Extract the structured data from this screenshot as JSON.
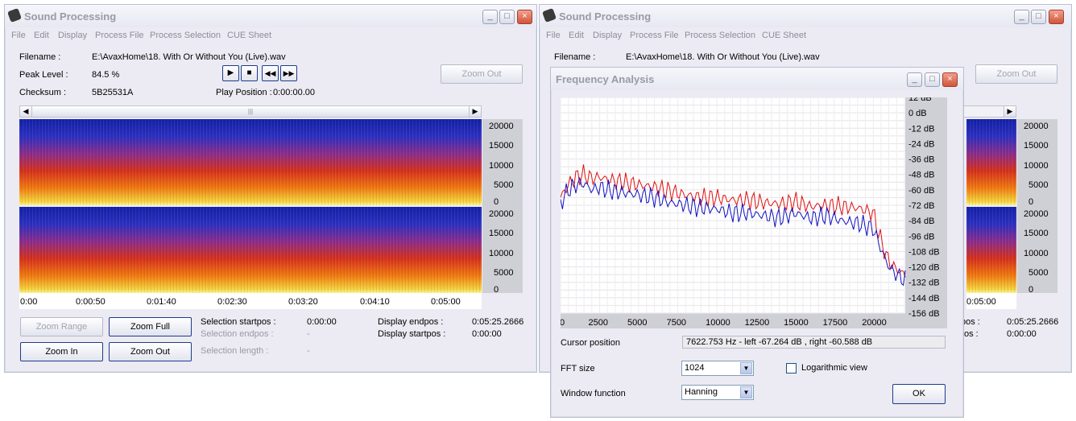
{
  "main_window": {
    "title": "Sound Processing",
    "menu": [
      "File",
      "Edit",
      "Display",
      "Process File",
      "Process Selection",
      "CUE Sheet"
    ],
    "filename_label": "Filename :",
    "filename_value": "E:\\AvaxHome\\18. With Or Without You (Live).wav",
    "peak_label": "Peak Level :",
    "peak_value": "84.5 %",
    "checksum_label": "Checksum :",
    "checksum_value": "5B25531A",
    "play_position_label": "Play Position :",
    "play_position_value": "0:00:00.00",
    "zoom_out_top": "Zoom Out",
    "freq_ticks": [
      "20000",
      "15000",
      "10000",
      "5000",
      "0"
    ],
    "time_ticks": [
      "0:00",
      "0:00:50",
      "0:01:40",
      "0:02:30",
      "0:03:20",
      "0:04:10",
      "0:05:00"
    ],
    "buttons": {
      "zoom_range": "Zoom Range",
      "zoom_full": "Zoom Full",
      "zoom_in": "Zoom In",
      "zoom_out": "Zoom Out"
    },
    "selection_startpos_label": "Selection startpos :",
    "selection_startpos_value": "0:00:00",
    "selection_endpos_label": "Selection endpos :",
    "selection_endpos_value": "-",
    "selection_length_label": "Selection length :",
    "selection_length_value": "-",
    "display_endpos_label": "Display endpos :",
    "display_endpos_value": "0:05:25.2666",
    "display_startpos_label": "Display startpos :",
    "display_startpos_value": "0:00:00"
  },
  "second_window": {
    "title": "Sound Processing",
    "menu": [
      "File",
      "Edit",
      "Display",
      "Process File",
      "Process Selection",
      "CUE Sheet"
    ],
    "filename_label": "Filename :",
    "filename_value": "E:\\AvaxHome\\18. With Or Without You (Live).wav",
    "zoom_out_top": "Zoom Out",
    "freq_ticks": [
      "20000",
      "15000",
      "10000",
      "5000",
      "0"
    ],
    "time_tick": "0:05:00",
    "pos_partial": "pos :",
    "pos_partial2": "os :",
    "display_endpos_value": "0:05:25.2666",
    "display_startpos_value": "0:00:00"
  },
  "freq_dialog": {
    "title": "Frequency Analysis",
    "cursor_label": "Cursor position",
    "cursor_value": "7622.753 Hz  -  left -67.264 dB , right -60.588 dB",
    "fft_label": "FFT size",
    "fft_value": "1024",
    "window_label": "Window function",
    "window_value": "Hanning",
    "log_label": "Logarithmic view",
    "ok": "OK"
  },
  "chart_data": {
    "type": "line",
    "xlim": [
      0,
      22050
    ],
    "ylim": [
      -156,
      12
    ],
    "x_ticks": [
      "0",
      "2500",
      "5000",
      "7500",
      "10000",
      "12500",
      "15000",
      "17500",
      "20000"
    ],
    "y_ticks": [
      "12 dB",
      "0 dB",
      "-12 dB",
      "-24 dB",
      "-36 dB",
      "-48 dB",
      "-60 dB",
      "-72 dB",
      "-84 dB",
      "-96 dB",
      "-108 dB",
      "-120 dB",
      "-132 dB",
      "-144 dB",
      "-156 dB"
    ],
    "grid": true,
    "series": [
      {
        "color": "#e01010",
        "x": [
          0,
          500,
          1000,
          1500,
          2000,
          2500,
          3000,
          4000,
          5000,
          6000,
          7000,
          8000,
          9000,
          10000,
          11000,
          12000,
          13000,
          14000,
          15000,
          16000,
          17000,
          18000,
          19000,
          20000,
          20500,
          21000,
          21500,
          22000
        ],
        "values": [
          -66,
          -56,
          -50,
          -48,
          -51,
          -50,
          -52,
          -54,
          -56,
          -58,
          -61,
          -64,
          -66,
          -66,
          -68,
          -68,
          -70,
          -71,
          -69,
          -73,
          -72,
          -73,
          -74,
          -78,
          -100,
          -116,
          -122,
          -126
        ]
      },
      {
        "color": "#1010c0",
        "x": [
          0,
          500,
          1000,
          1500,
          2000,
          2500,
          3000,
          4000,
          5000,
          6000,
          7000,
          8000,
          9000,
          10000,
          11000,
          12000,
          13000,
          14000,
          15000,
          16000,
          17000,
          18000,
          19000,
          20000,
          20500,
          21000,
          21500,
          22000
        ],
        "values": [
          -70,
          -60,
          -56,
          -55,
          -60,
          -58,
          -60,
          -62,
          -64,
          -66,
          -70,
          -72,
          -74,
          -75,
          -78,
          -78,
          -80,
          -82,
          -78,
          -82,
          -80,
          -84,
          -86,
          -90,
          -106,
          -120,
          -126,
          -130
        ]
      }
    ]
  }
}
